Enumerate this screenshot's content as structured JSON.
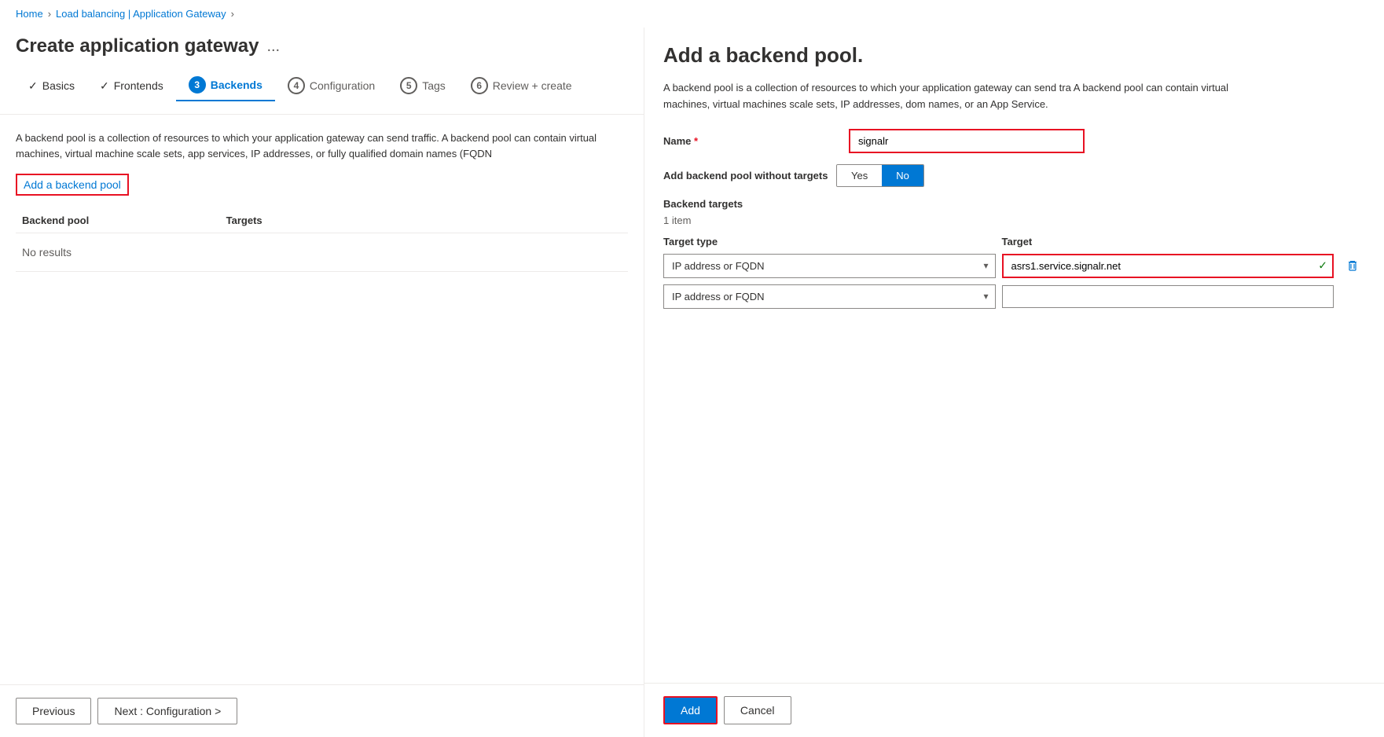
{
  "breadcrumb": {
    "home": "Home",
    "separator1": ">",
    "loadbalancing": "Load balancing | Application Gateway",
    "separator2": ">"
  },
  "pageTitle": "Create application gateway",
  "moreOptions": "...",
  "steps": [
    {
      "id": "basics",
      "label": "Basics",
      "state": "completed",
      "number": ""
    },
    {
      "id": "frontends",
      "label": "Frontends",
      "state": "completed",
      "number": ""
    },
    {
      "id": "backends",
      "label": "Backends",
      "state": "active",
      "number": "3"
    },
    {
      "id": "configuration",
      "label": "Configuration",
      "state": "inactive",
      "number": "4"
    },
    {
      "id": "tags",
      "label": "Tags",
      "state": "inactive",
      "number": "5"
    },
    {
      "id": "review",
      "label": "Review + create",
      "state": "inactive",
      "number": "6"
    }
  ],
  "leftDescription": "A backend pool is a collection of resources to which your application gateway can send traffic. A backend pool can contain virtual machines, virtual machine scale sets, app services, IP addresses, or fully qualified domain names (FQDN",
  "addBackendPoolLink": "Add a backend pool",
  "tableHeaders": {
    "backendPool": "Backend pool",
    "targets": "Targets"
  },
  "noResults": "No results",
  "bottomBar": {
    "previous": "Previous",
    "next": "Next : Configuration >"
  },
  "rightPanel": {
    "title": "Add a backend pool.",
    "description": "A backend pool is a collection of resources to which your application gateway can send tra A backend pool can contain virtual machines, virtual machines scale sets, IP addresses, dom names, or an App Service.",
    "nameLabel": "Name",
    "nameRequired": "*",
    "nameValue": "signalr",
    "toggleLabel": "Add backend pool without targets",
    "toggleYes": "Yes",
    "toggleNo": "No",
    "toggleActive": "No",
    "backendTargetsLabel": "Backend targets",
    "itemCount": "1 item",
    "colTargetType": "Target type",
    "colTarget": "Target",
    "row1": {
      "targetType": "IP address or FQDN",
      "target": "asrs1.service.signalr.net",
      "hasValue": true
    },
    "row2": {
      "targetType": "IP address or FQDN",
      "target": "",
      "hasValue": false
    },
    "addButton": "Add",
    "cancelButton": "Cancel"
  }
}
